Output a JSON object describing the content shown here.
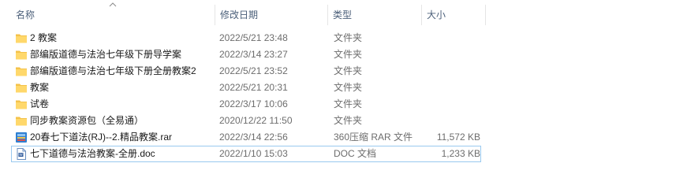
{
  "columns": {
    "name": "名称",
    "date": "修改日期",
    "type": "类型",
    "size": "大小"
  },
  "files": [
    {
      "name": "2 教案",
      "date": "2022/5/21 23:48",
      "type": "文件夹",
      "size": "",
      "icon": "folder-icon"
    },
    {
      "name": "部编版道德与法治七年级下册导学案",
      "date": "2022/3/14 23:27",
      "type": "文件夹",
      "size": "",
      "icon": "folder-icon"
    },
    {
      "name": "部编版道德与法治七年级下册全册教案2",
      "date": "2022/5/21 23:52",
      "type": "文件夹",
      "size": "",
      "icon": "folder-icon"
    },
    {
      "name": "教案",
      "date": "2022/5/21 20:31",
      "type": "文件夹",
      "size": "",
      "icon": "folder-icon"
    },
    {
      "name": "试卷",
      "date": "2022/3/17 10:06",
      "type": "文件夹",
      "size": "",
      "icon": "folder-icon"
    },
    {
      "name": "同步教案资源包（全易通）",
      "date": "2020/12/22 11:50",
      "type": "文件夹",
      "size": "",
      "icon": "folder-icon"
    },
    {
      "name": "20春七下道法(RJ)--2.精品教案.rar",
      "date": "2022/3/14 22:56",
      "type": "360压缩 RAR 文件",
      "size": "11,572 KB",
      "icon": "rar-archive-icon"
    },
    {
      "name": "七下道德与法治教案-全册.doc",
      "date": "2022/1/10 15:03",
      "type": "DOC 文档",
      "size": "1,233 KB",
      "icon": "doc-file-icon"
    }
  ],
  "colors": {
    "header_text": "#4c607a",
    "folder": "#f4c24a",
    "selection_border": "#99c9ef"
  }
}
